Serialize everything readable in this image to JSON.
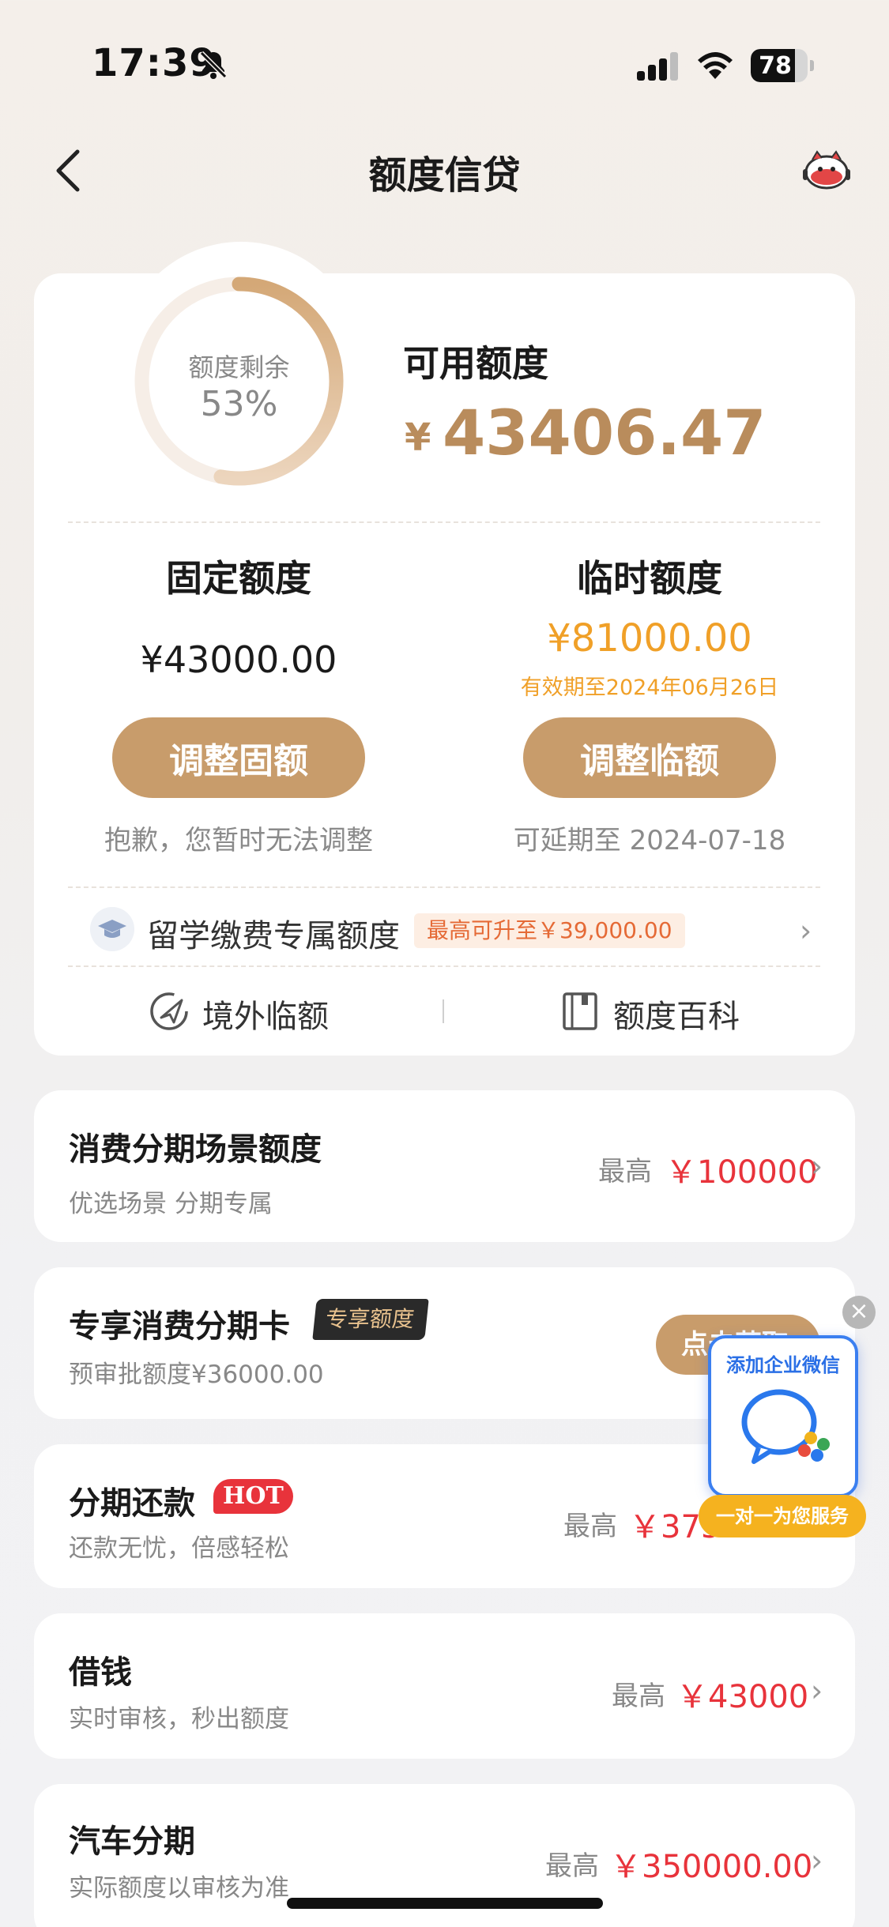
{
  "status_bar": {
    "time": "17:39",
    "battery": "78",
    "battery_level": 0.78
  },
  "nav": {
    "title": "额度信贷"
  },
  "summary": {
    "ring_label": "额度剩余",
    "ring_percent": "53%",
    "ring_fraction": 0.53,
    "available_label": "可用额度",
    "currency_symbol": "¥",
    "available_amount": "43406.47"
  },
  "fixed": {
    "title": "固定额度",
    "amount": "¥43000.00",
    "button": "调整固额",
    "note": "抱歉，您暂时无法调整"
  },
  "temporary": {
    "title": "临时额度",
    "amount": "¥81000.00",
    "valid": "有效期至2024年06月26日",
    "button": "调整临额",
    "note": "可延期至 2024-07-18"
  },
  "study": {
    "label": "留学缴费专属额度",
    "badge": "最高可升至￥39,000.00"
  },
  "tools": {
    "overseas": "境外临额",
    "wiki": "额度百科"
  },
  "list": [
    {
      "title": "消费分期场景额度",
      "sub": "优选场景 分期专属",
      "prefix": "最高",
      "amount": "￥100000"
    },
    {
      "title": "专享消费分期卡",
      "tag": "专享额度",
      "sub": "预审批额度¥36000.00",
      "button": "点击获取"
    },
    {
      "title": "分期还款",
      "tag": "HOT",
      "sub": "还款无忧，倍感轻松",
      "prefix": "最高",
      "amount": "￥375"
    },
    {
      "title": "借钱",
      "sub": "实时审核，秒出额度",
      "prefix": "最高",
      "amount": "￥43000"
    },
    {
      "title": "汽车分期",
      "sub": "实际额度以审核为准",
      "prefix": "最高",
      "amount": "￥350000.00"
    }
  ],
  "wechat_widget": {
    "top_text": "添加企业微信",
    "bottom_text": "一对一为您服务",
    "close": "×"
  },
  "colors": {
    "accent": "#c89c6b",
    "amount_red": "#e8333b",
    "temp_orange": "#f0a028",
    "gold_text": "#b98c5c"
  },
  "icons": [
    "bell-slash-icon",
    "signal-icon",
    "wifi-icon",
    "battery-icon",
    "back-icon",
    "mascot-icon",
    "graduation-cap-icon",
    "plane-icon",
    "book-icon",
    "chevron-right-icon",
    "close-icon",
    "wechat-work-icon"
  ]
}
